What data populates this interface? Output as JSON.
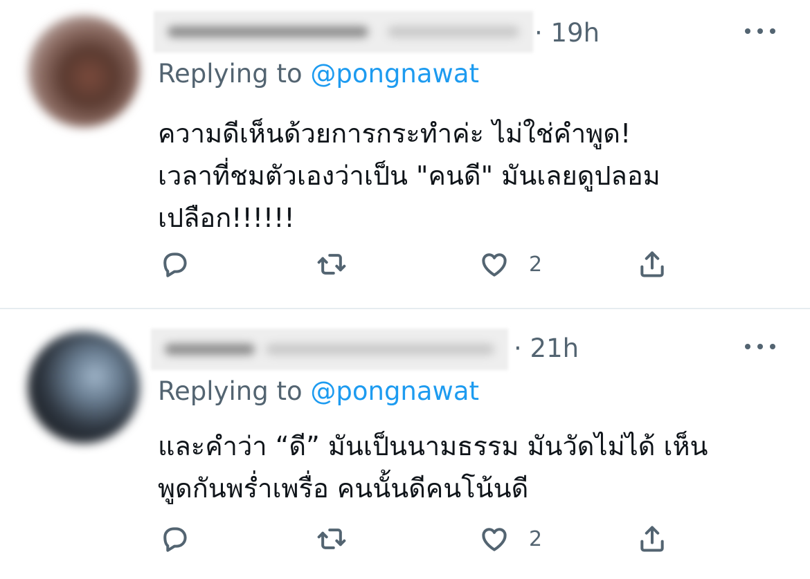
{
  "tweets": [
    {
      "timestamp": "· 19h",
      "replying_prefix": "Replying to",
      "replying_handle": "@pongnawat",
      "text": "ความดีเห็นด้วยการกระทำค่ะ ไม่ใช่คำพูด!\nเวลาที่ชมตัวเองว่าเป็น \"คนดี\" มันเลยดูปลอม\nเปลือก!!!!!!",
      "like_count": "2"
    },
    {
      "timestamp": "· 21h",
      "replying_prefix": "Replying to",
      "replying_handle": "@pongnawat",
      "text": "และคำว่า “ดี” มันเป็นนามธรรม มันวัดไม่ได้ เห็น\nพูดกันพร่ำเพรื่อ คนนั้นดีคนโน้นดี",
      "like_count": "2"
    }
  ],
  "icons": {
    "reply": "reply-icon",
    "retweet": "retweet-icon",
    "like": "heart-icon",
    "share": "share-icon",
    "more": "more-icon"
  },
  "colors": {
    "secondary_text": "#536471",
    "link": "#1d9bf0",
    "primary_text": "#0f1419",
    "divider": "#e6ecf0"
  }
}
